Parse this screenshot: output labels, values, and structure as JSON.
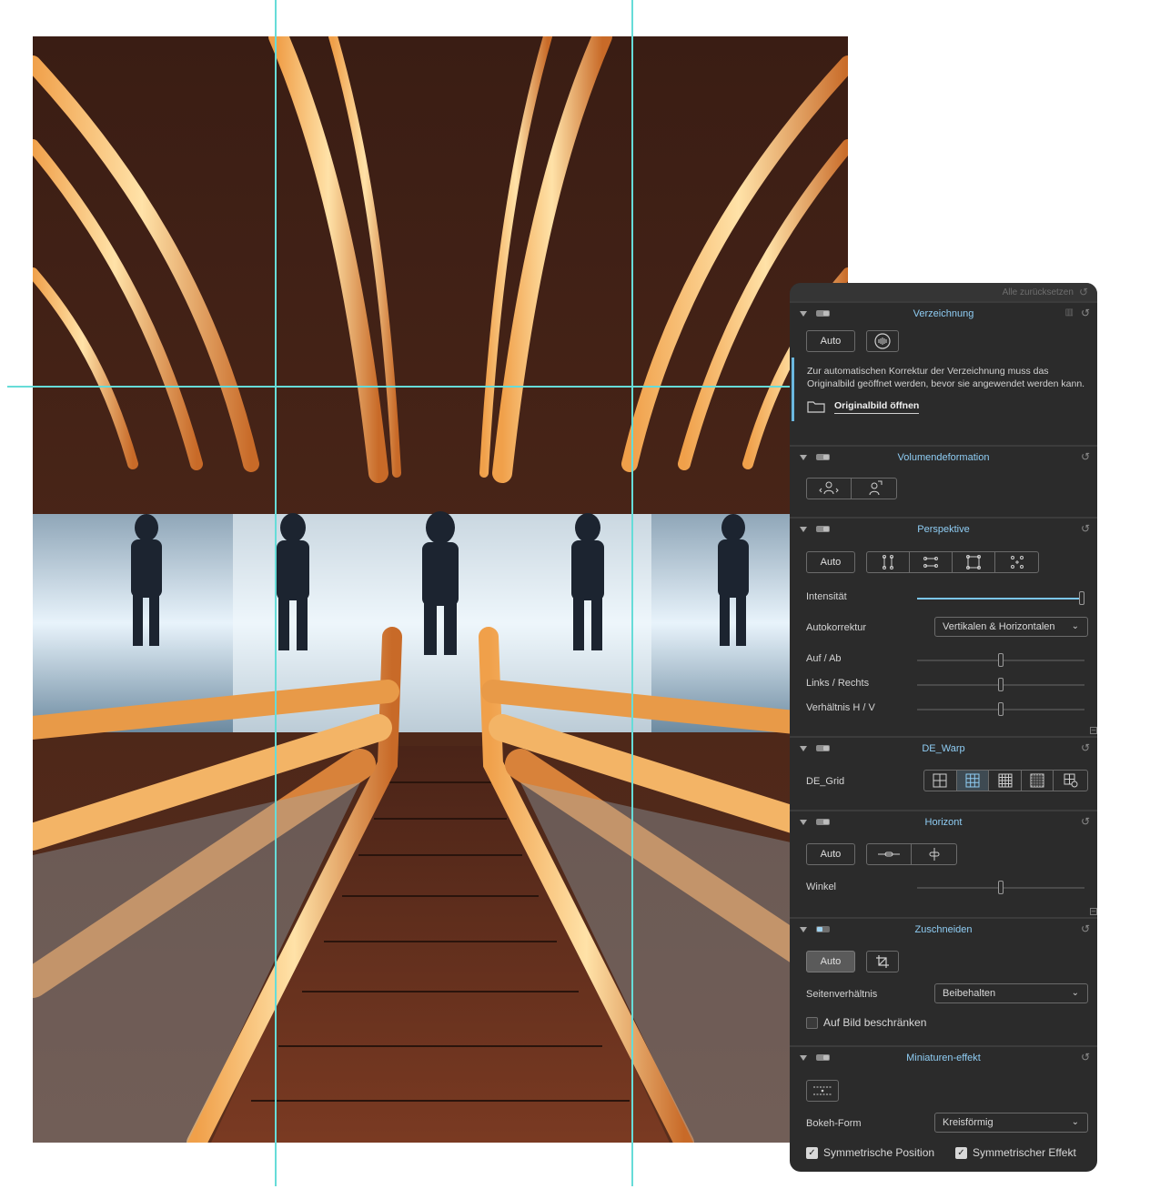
{
  "panel": {
    "reset_all": "Alle zurücksetzen",
    "verzeichnung": {
      "title": "Verzeichnung",
      "auto": "Auto",
      "note": "Zur automatischen Korrektur der Verzeichnung muss das Originalbild geöffnet werden, bevor sie angewendet werden kann.",
      "open_original": "Originalbild öffnen"
    },
    "volumendeformation": {
      "title": "Volumendeformation"
    },
    "perspektive": {
      "title": "Perspektive",
      "auto": "Auto",
      "intensitaet_label": "Intensität",
      "intensitaet_value": 1.0,
      "autokorrektur_label": "Autokorrektur",
      "autokorrektur_value": "Vertikalen & Horizontalen",
      "auf_ab_label": "Auf / Ab",
      "auf_ab_value": 0.5,
      "links_rechts_label": "Links / Rechts",
      "links_rechts_value": 0.5,
      "verhaeltnis_label": "Verhältnis H / V",
      "verhaeltnis_value": 0.5
    },
    "dewarp": {
      "title": "DE_Warp",
      "grid_label": "DE_Grid"
    },
    "horizont": {
      "title": "Horizont",
      "auto": "Auto",
      "winkel_label": "Winkel",
      "winkel_value": 0.5
    },
    "zuschneiden": {
      "title": "Zuschneiden",
      "auto": "Auto",
      "seitenverhaeltnis_label": "Seitenverhältnis",
      "seitenverhaeltnis_value": "Beibehalten",
      "auf_bild_label": "Auf Bild beschränken",
      "auf_bild_checked": false
    },
    "miniaturen": {
      "title": "Miniaturen-effekt",
      "bokeh_label": "Bokeh-Form",
      "bokeh_value": "Kreisförmig",
      "sym_pos_label": "Symmetrische Position",
      "sym_pos_checked": true,
      "sym_eff_label": "Symmetrischer Effekt",
      "sym_eff_checked": true
    }
  },
  "colors": {
    "panel_bg": "#2b2b2b",
    "accent_blue": "#8fcdf4",
    "guide_cyan": "#66dcd8"
  }
}
